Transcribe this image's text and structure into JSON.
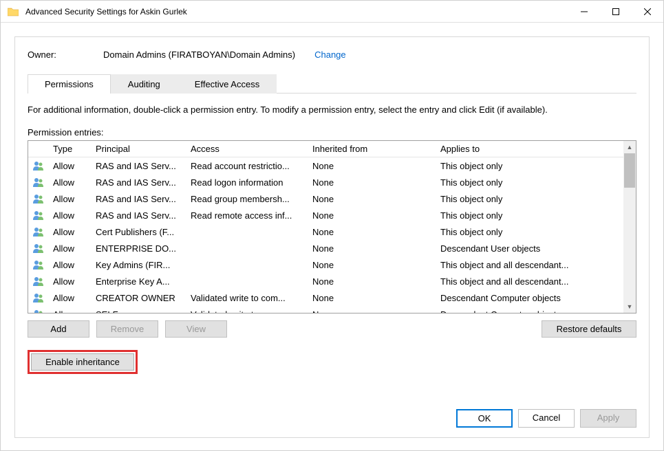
{
  "window": {
    "title": "Advanced Security Settings for Askin Gurlek"
  },
  "owner": {
    "label": "Owner:",
    "value": "Domain Admins (FIRATBOYAN\\Domain Admins)",
    "change": "Change"
  },
  "tabs": {
    "permissions": "Permissions",
    "auditing": "Auditing",
    "effective": "Effective Access",
    "active": 0
  },
  "info_text": "For additional information, double-click a permission entry. To modify a permission entry, select the entry and click Edit (if available).",
  "entries_label": "Permission entries:",
  "columns": {
    "type": "Type",
    "principal": "Principal",
    "access": "Access",
    "inherited": "Inherited from",
    "applies": "Applies to"
  },
  "rows": [
    {
      "type": "Allow",
      "principal": "RAS and IAS Serv...",
      "access": "Read account restrictio...",
      "inherited": "None",
      "applies": "This object only"
    },
    {
      "type": "Allow",
      "principal": "RAS and IAS Serv...",
      "access": "Read logon information",
      "inherited": "None",
      "applies": "This object only"
    },
    {
      "type": "Allow",
      "principal": "RAS and IAS Serv...",
      "access": "Read group membersh...",
      "inherited": "None",
      "applies": "This object only"
    },
    {
      "type": "Allow",
      "principal": "RAS and IAS Serv...",
      "access": "Read remote access inf...",
      "inherited": "None",
      "applies": "This object only"
    },
    {
      "type": "Allow",
      "principal": "Cert Publishers (F...",
      "access": "",
      "inherited": "None",
      "applies": "This object only"
    },
    {
      "type": "Allow",
      "principal": "ENTERPRISE DO...",
      "access": "",
      "inherited": "None",
      "applies": "Descendant User objects"
    },
    {
      "type": "Allow",
      "principal": "Key Admins (FIR...",
      "access": "",
      "inherited": "None",
      "applies": "This object and all descendant..."
    },
    {
      "type": "Allow",
      "principal": "Enterprise Key A...",
      "access": "",
      "inherited": "None",
      "applies": "This object and all descendant..."
    },
    {
      "type": "Allow",
      "principal": "CREATOR OWNER",
      "access": "Validated write to com...",
      "inherited": "None",
      "applies": "Descendant Computer objects"
    },
    {
      "type": "Allow",
      "principal": "SELF",
      "access": "Validated write to com...",
      "inherited": "None",
      "applies": "Descendant Computer objects"
    }
  ],
  "buttons": {
    "add": "Add",
    "remove": "Remove",
    "view": "View",
    "restore": "Restore defaults",
    "enable_inheritance": "Enable inheritance",
    "ok": "OK",
    "cancel": "Cancel",
    "apply": "Apply"
  }
}
